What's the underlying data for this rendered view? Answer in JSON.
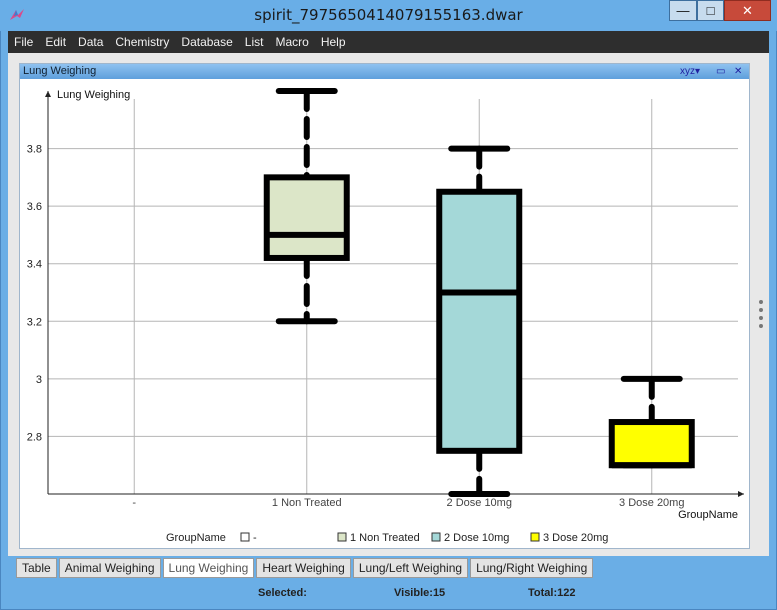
{
  "window": {
    "title": "spirit_7975650414079155163.dwar",
    "min_label": "—",
    "max_label": "□",
    "close_label": "✕"
  },
  "menu": [
    "File",
    "Edit",
    "Data",
    "Chemistry",
    "Database",
    "List",
    "Macro",
    "Help"
  ],
  "view": {
    "title": "Lung Weighing",
    "controls": [
      "xyz▾",
      "▭",
      "✕"
    ]
  },
  "tabs": [
    {
      "label": "Table",
      "active": false
    },
    {
      "label": "Animal Weighing",
      "active": false
    },
    {
      "label": "Lung Weighing",
      "active": true
    },
    {
      "label": "Heart Weighing",
      "active": false
    },
    {
      "label": "Lung/Left Weighing",
      "active": false
    },
    {
      "label": "Lung/Right Weighing",
      "active": false
    }
  ],
  "status": {
    "selected_label": "Selected:",
    "selected_value": "",
    "visible_label": "Visible:",
    "visible_value": "15",
    "total_label": "Total:",
    "total_value": "122"
  },
  "chart_data": {
    "type": "boxplot",
    "ylabel": "Lung Weighing",
    "xlabel": "GroupName",
    "ylim": [
      2.6,
      4.0
    ],
    "yticks": [
      2.8,
      3,
      3.2,
      3.4,
      3.6,
      3.8
    ],
    "ytick_labels": [
      "2.8",
      "3",
      "3.2",
      "3.4",
      "3.6",
      "3.8"
    ],
    "categories": [
      "-",
      "1 Non Treated",
      "2 Dose 10mg",
      "3 Dose 20mg"
    ],
    "boxes": [
      {
        "category": "1 Non Treated",
        "min": 3.2,
        "q1": 3.42,
        "median": 3.5,
        "q3": 3.7,
        "max": 4.0,
        "color": "#dce6c8"
      },
      {
        "category": "2 Dose 10mg",
        "min": 2.6,
        "q1": 2.75,
        "median": 3.3,
        "q3": 3.65,
        "max": 3.8,
        "color": "#a4d8d8"
      },
      {
        "category": "3 Dose 20mg",
        "min": 2.7,
        "q1": 2.7,
        "median": 2.7,
        "q3": 2.85,
        "max": 3.0,
        "color": "#ffff00"
      }
    ],
    "legend": {
      "title": "GroupName",
      "entries": [
        {
          "label": "-",
          "color": "#ffffff"
        },
        {
          "label": "1 Non Treated",
          "color": "#dce6c8"
        },
        {
          "label": "2 Dose 10mg",
          "color": "#a4d8d8"
        },
        {
          "label": "3 Dose 20mg",
          "color": "#ffff00"
        }
      ],
      "placement": "bottom"
    },
    "grid": true
  }
}
